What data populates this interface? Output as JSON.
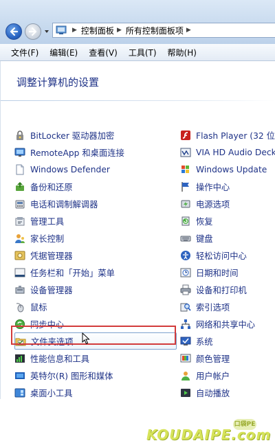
{
  "breadcrumb": {
    "root_icon": "control-panel-icon",
    "items": [
      "控制面板",
      "所有控制面板项"
    ],
    "separator": "▶"
  },
  "menu": [
    "文件(F)",
    "编辑(E)",
    "查看(V)",
    "工具(T)",
    "帮助(H)"
  ],
  "page_title": "调整计算机的设置",
  "left_items": [
    {
      "label": "BitLocker 驱动器加密",
      "icon": "bitlocker-icon"
    },
    {
      "label": "RemoteApp 和桌面连接",
      "icon": "remoteapp-icon"
    },
    {
      "label": "Windows Defender",
      "icon": "defender-icon"
    },
    {
      "label": "备份和还原",
      "icon": "backup-icon"
    },
    {
      "label": "电话和调制解调器",
      "icon": "phone-modem-icon"
    },
    {
      "label": "管理工具",
      "icon": "admin-tools-icon"
    },
    {
      "label": "家长控制",
      "icon": "parental-control-icon"
    },
    {
      "label": "凭据管理器",
      "icon": "credential-icon"
    },
    {
      "label": "任务栏和「开始」菜单",
      "icon": "taskbar-icon"
    },
    {
      "label": "设备管理器",
      "icon": "device-manager-icon"
    },
    {
      "label": "鼠标",
      "icon": "mouse-icon"
    },
    {
      "label": "同步中心",
      "icon": "sync-icon"
    },
    {
      "label": "文件夹选项",
      "icon": "folder-options-icon"
    },
    {
      "label": "性能信息和工具",
      "icon": "performance-icon"
    },
    {
      "label": "英特尔(R) 图形和媒体",
      "icon": "intel-graphics-icon"
    },
    {
      "label": "桌面小工具",
      "icon": "gadgets-icon"
    }
  ],
  "right_items": [
    {
      "label": "Flash Player (32 位)",
      "icon": "flash-icon"
    },
    {
      "label": "VIA HD Audio Deck",
      "icon": "audio-deck-icon"
    },
    {
      "label": "Windows Update",
      "icon": "windows-update-icon"
    },
    {
      "label": "操作中心",
      "icon": "action-center-icon"
    },
    {
      "label": "电源选项",
      "icon": "power-icon"
    },
    {
      "label": "恢复",
      "icon": "recovery-icon"
    },
    {
      "label": "键盘",
      "icon": "keyboard-icon"
    },
    {
      "label": "轻松访问中心",
      "icon": "ease-access-icon"
    },
    {
      "label": "日期和时间",
      "icon": "clock-icon"
    },
    {
      "label": "设备和打印机",
      "icon": "printer-icon"
    },
    {
      "label": "索引选项",
      "icon": "indexing-icon"
    },
    {
      "label": "网络和共享中心",
      "icon": "network-icon"
    },
    {
      "label": "系统",
      "icon": "system-icon"
    },
    {
      "label": "颜色管理",
      "icon": "color-management-icon"
    },
    {
      "label": "用户帐户",
      "icon": "user-accounts-icon"
    },
    {
      "label": "自动播放",
      "icon": "autoplay-icon"
    }
  ],
  "selected_item": "文件夹选项",
  "watermark": {
    "text": "KOUDAIPE.com",
    "badge": "口袋PE"
  },
  "colors": {
    "link": "#1e3287",
    "highlight_border": "#d23a3a",
    "selected_border": "#7da2ce"
  }
}
